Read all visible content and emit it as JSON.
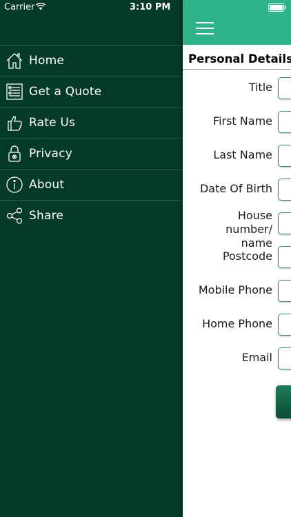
{
  "status_bar": {
    "carrier": "Carrier",
    "time": "3:10 PM"
  },
  "menu": {
    "items": [
      {
        "label": "Home",
        "icon": "home-icon"
      },
      {
        "label": "Get a Quote",
        "icon": "quote-form-icon"
      },
      {
        "label": "Rate Us",
        "icon": "thumbs-up-icon"
      },
      {
        "label": "Privacy",
        "icon": "lock-icon"
      },
      {
        "label": "About",
        "icon": "info-icon"
      },
      {
        "label": "Share",
        "icon": "share-icon"
      }
    ]
  },
  "form": {
    "section_title": "Personal Details",
    "fields": [
      {
        "label": "Title"
      },
      {
        "label": "First Name"
      },
      {
        "label": "Last Name"
      },
      {
        "label": "Date Of Birth"
      },
      {
        "label": "House number/ name"
      },
      {
        "label": "Postcode"
      },
      {
        "label": "Mobile Phone"
      },
      {
        "label": "Home Phone"
      },
      {
        "label": "Email"
      }
    ]
  },
  "colors": {
    "menu_background": "#053a28",
    "navbar": "#2fb38a",
    "field_border": "#3f8a6d",
    "button": "#0b4d34"
  }
}
